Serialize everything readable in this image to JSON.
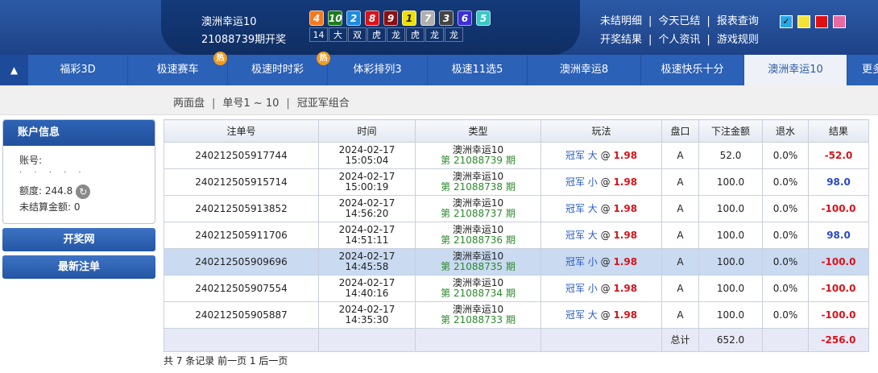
{
  "header": {
    "game_title": "澳洲幸运10",
    "draw_no": "21088739期开奖",
    "balls": [
      {
        "num": "4",
        "color": "#f47a1f"
      },
      {
        "num": "10",
        "color": "#1d7b1d"
      },
      {
        "num": "2",
        "color": "#1f8be0"
      },
      {
        "num": "8",
        "color": "#d8141b"
      },
      {
        "num": "9",
        "color": "#8b0f13"
      },
      {
        "num": "1",
        "color": "#f0e000"
      },
      {
        "num": "7",
        "color": "#b0b0b0"
      },
      {
        "num": "3",
        "color": "#444444"
      },
      {
        "num": "6",
        "color": "#3a2fd8"
      },
      {
        "num": "5",
        "color": "#39c8c8"
      }
    ],
    "stats": [
      "14",
      "大",
      "双",
      "虎",
      "龙",
      "虎",
      "龙",
      "龙"
    ],
    "links_row1": [
      "未结明细",
      "今天已结",
      "报表查询"
    ],
    "links_row2": [
      "开奖结果",
      "个人资讯",
      "游戏规则"
    ],
    "skins": [
      {
        "color": "#27a6e8",
        "check": "✓"
      },
      {
        "color": "#f4e23a",
        "check": ""
      },
      {
        "color": "#e01010",
        "check": ""
      },
      {
        "color": "#e86aa0",
        "check": ""
      }
    ]
  },
  "nav": {
    "arrow": "▲",
    "items": [
      "福彩3D",
      "极速赛车",
      "极速时时彩",
      "体彩排列3",
      "极速11选5",
      "澳洲幸运8",
      "极速快乐十分",
      "澳洲幸运10",
      "更多"
    ],
    "hot_label": "热"
  },
  "subtabs": [
    "两面盘",
    "单号1 ~ 10",
    "冠亚军组合"
  ],
  "account": {
    "title": "账户信息",
    "account_label": "账号:",
    "account_masked": "· · · · ·",
    "balance": "额度: 244.8",
    "refresh_glyph": "↻",
    "unsettled": "未结算金额: 0",
    "btn_lottery_site": "开奖网",
    "btn_latest_bets": "最新注单"
  },
  "table": {
    "headers": [
      "注单号",
      "时间",
      "类型",
      "玩法",
      "盘口",
      "下注金额",
      "退水",
      "结果"
    ],
    "rows": [
      {
        "id": "240212505917744",
        "date": "2024-02-17",
        "time": "15:05:04",
        "game": "澳洲幸运10",
        "issue": "第 21088739 期",
        "play": "冠军 大",
        "at": "@",
        "odds": "1.98",
        "pan": "A",
        "amount": "52.0",
        "rebate": "0.0%",
        "result": "-52.0",
        "res_pos": false
      },
      {
        "id": "240212505915714",
        "date": "2024-02-17",
        "time": "15:00:19",
        "game": "澳洲幸运10",
        "issue": "第 21088738 期",
        "play": "冠军 小",
        "at": "@",
        "odds": "1.98",
        "pan": "A",
        "amount": "100.0",
        "rebate": "0.0%",
        "result": "98.0",
        "res_pos": true
      },
      {
        "id": "240212505913852",
        "date": "2024-02-17",
        "time": "14:56:20",
        "game": "澳洲幸运10",
        "issue": "第 21088737 期",
        "play": "冠军 大",
        "at": "@",
        "odds": "1.98",
        "pan": "A",
        "amount": "100.0",
        "rebate": "0.0%",
        "result": "-100.0",
        "res_pos": false
      },
      {
        "id": "240212505911706",
        "date": "2024-02-17",
        "time": "14:51:11",
        "game": "澳洲幸运10",
        "issue": "第 21088736 期",
        "play": "冠军 大",
        "at": "@",
        "odds": "1.98",
        "pan": "A",
        "amount": "100.0",
        "rebate": "0.0%",
        "result": "98.0",
        "res_pos": true
      },
      {
        "id": "240212505909696",
        "date": "2024-02-17",
        "time": "14:45:58",
        "game": "澳洲幸运10",
        "issue": "第 21088735 期",
        "play": "冠军 小",
        "at": "@",
        "odds": "1.98",
        "pan": "A",
        "amount": "100.0",
        "rebate": "0.0%",
        "result": "-100.0",
        "res_pos": false
      },
      {
        "id": "240212505907554",
        "date": "2024-02-17",
        "time": "14:40:16",
        "game": "澳洲幸运10",
        "issue": "第 21088734 期",
        "play": "冠军 小",
        "at": "@",
        "odds": "1.98",
        "pan": "A",
        "amount": "100.0",
        "rebate": "0.0%",
        "result": "-100.0",
        "res_pos": false
      },
      {
        "id": "240212505905887",
        "date": "2024-02-17",
        "time": "14:35:30",
        "game": "澳洲幸运10",
        "issue": "第 21088733 期",
        "play": "冠军 大",
        "at": "@",
        "odds": "1.98",
        "pan": "A",
        "amount": "100.0",
        "rebate": "0.0%",
        "result": "-100.0",
        "res_pos": false
      }
    ],
    "selected_row_index": 4,
    "summary": {
      "label": "总计",
      "amount": "652.0",
      "result": "-256.0"
    }
  },
  "pager": "共 7 条记录 前一页 1 后一页"
}
